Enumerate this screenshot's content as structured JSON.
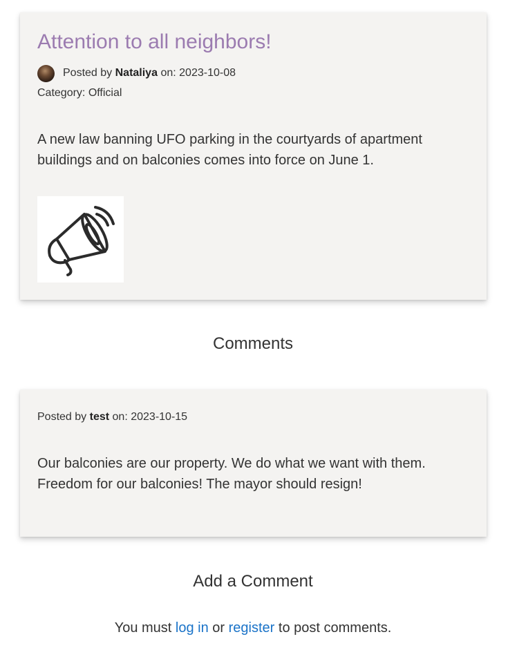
{
  "post": {
    "title": "Attention to all neighbors!",
    "posted_by_prefix": "Posted by",
    "author": "Nataliya",
    "on_label": "on:",
    "date": "2023-10-08",
    "category_label": "Category:",
    "category": "Official",
    "body": "A new law banning UFO parking in the courtyards of apartment buildings and on balconies comes into force on June 1.",
    "image_icon": "megaphone-icon"
  },
  "comments_section": {
    "heading": "Comments",
    "items": [
      {
        "posted_by_prefix": "Posted by",
        "author": "test",
        "on_label": "on:",
        "date": "2023-10-15",
        "body": "Our balconies are our property. We do what we want with them. Freedom for our balconies! The mayor should resign!"
      }
    ]
  },
  "add_comment": {
    "heading": "Add a Comment",
    "prefix": "You must",
    "login_label": "log in",
    "or_label": "or",
    "register_label": "register",
    "suffix": "to post comments."
  },
  "colors": {
    "title": "#9b7bb0",
    "link": "#1a73c8",
    "card_bg": "#f4f3f1",
    "text": "#333333"
  }
}
